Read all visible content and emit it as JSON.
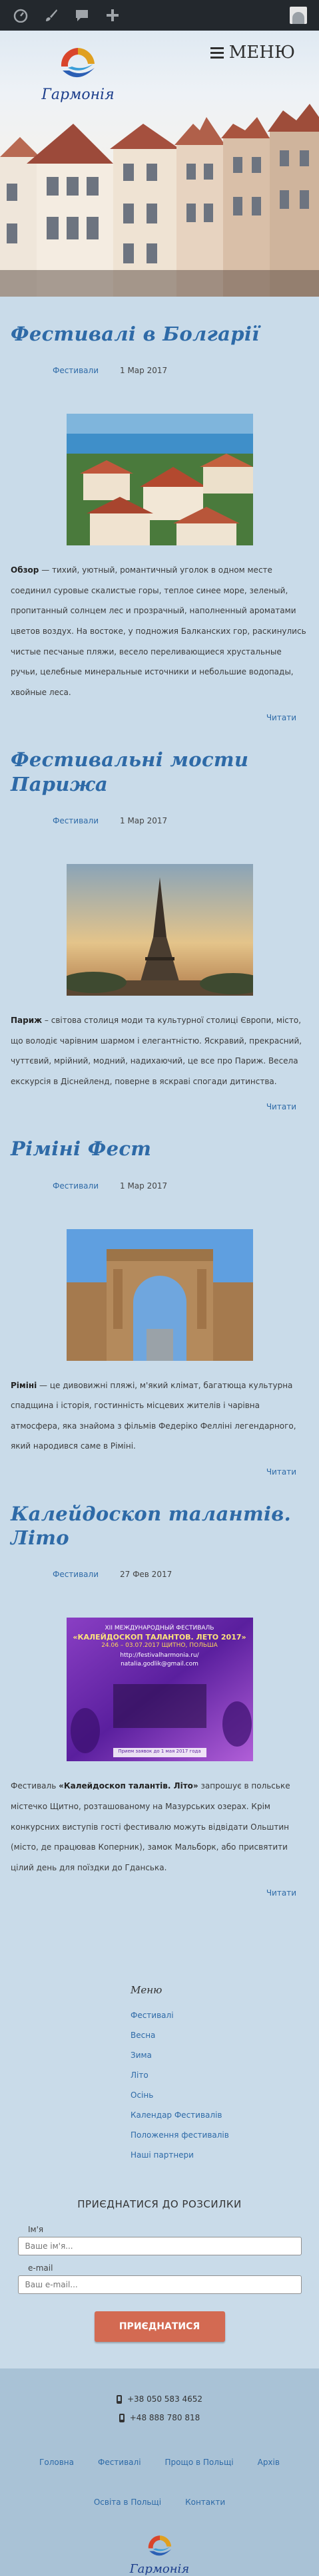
{
  "admin_bar": {
    "icons": [
      "dashboard-icon",
      "customize-icon",
      "comments-icon",
      "new-content-icon",
      "avatar-icon"
    ]
  },
  "header": {
    "menu_label": "МЕНЮ",
    "logo_text": "Гармонія"
  },
  "posts": [
    {
      "title": "Фестивалі в Болгарії",
      "category": "Фестивали",
      "date": "1 Мар 2017",
      "excerpt_lead": "Обзор",
      "excerpt": " — тихий, уютный, романтичный уголок в одном месте соединил суровые скалистые горы, теплое синее море, зеленый, пропитанный солнцем лес и прозрачный, наполненный ароматами цветов воздух. На востоке, у подножия Балканских гор, раскинулись чистые песчаные пляжи, весело переливающиеся хрустальные ручьи, целебные минеральные источники и небольшие водопады, хвойные леса.",
      "read_more": "Читати"
    },
    {
      "title": "Фестивальні мости Парижа",
      "category": "Фестивали",
      "date": "1 Мар 2017",
      "excerpt_lead": "Париж",
      "excerpt": " – світова столиця моди та культурної столиці Європи, місто, що володіє чарівним шармом і елегантністю. Яскравий, прекрасний, чуттєвий, мрійний, модний, надихаючий, це все про Париж. Весела екскурсія в Діснейленд, поверне в яскраві спогади дитинства.",
      "read_more": "Читати"
    },
    {
      "title": "Ріміні Фест",
      "category": "Фестивали",
      "date": "1 Мар 2017",
      "excerpt_lead": "Ріміні",
      "excerpt": " — це дивовижні пляжі, м'який клімат, багатюща культурна спадщина і історія, гостинність місцевих жителів і чарівна атмосфера, яка знайома з фільмів Федеріко Фелліні легендарного, який народився саме в Ріміні.",
      "read_more": "Читати"
    },
    {
      "title": "Калейдоскоп талантів. Літо",
      "category": "Фестивали",
      "date": "27 Фев 2017",
      "excerpt_lead": "«Калейдоскоп талантів. Літо»",
      "excerpt_prefix": "Фестиваль ",
      "excerpt": " запрошує в польське містечко Щитно, розташованому на Мазурських озерах. Крім конкурсних виступів гості фестивалю можуть відвідати Ольштин (місто, де працював Коперник), замок Мальборк, або присвятити цілий день для поїздки до Гданська.",
      "read_more": "Читати",
      "poster": {
        "line1": "XII МЕЖДУНАРОДНЫЙ ФЕСТИВАЛЬ",
        "line2": "«КАЛЕЙДОСКОП ТАЛАНТОВ. ЛЕТО 2017»",
        "line3": "24.06 – 03.07.2017 ЩИТНО, ПОЛЬША",
        "line4": "http://festivalharmonia.ru/",
        "line5": "natalia.godlik@gmail.com",
        "line6": "Прием заявок до 1 мая 2017 года"
      }
    }
  ],
  "widget_menu": {
    "title": "Меню",
    "items": [
      "Фестивалі",
      "Весна",
      "Зима",
      "Літо",
      "Осінь",
      "Календар Фестивалів",
      "Положення фестивалів",
      "Наші партнери"
    ]
  },
  "subscribe": {
    "title": "ПРИЄДНАТИСЯ ДО РОЗСИЛКИ",
    "name_label": "Ім'я",
    "name_placeholder": "Ваше ім'я...",
    "email_label": "e-mail",
    "email_placeholder": "Ваш e-mail...",
    "button_label": "ПРИЄДНАТИСЯ"
  },
  "footer": {
    "phones": [
      "+38 050 583 4652",
      "+48 888 780 818"
    ],
    "nav_row1": [
      "Головна",
      "Фестивалі",
      "Прощо в Польщі",
      "Архів"
    ],
    "nav_row2": [
      "Освіта в Польщі",
      "Контакти"
    ],
    "logo_text": "Гармонія"
  },
  "colors": {
    "page_bg": "#c9dbe9",
    "accent": "#2e6aa7",
    "button": "#d36a52",
    "admin_bar": "#23282d",
    "footer_bg": "#a9c2d6"
  }
}
